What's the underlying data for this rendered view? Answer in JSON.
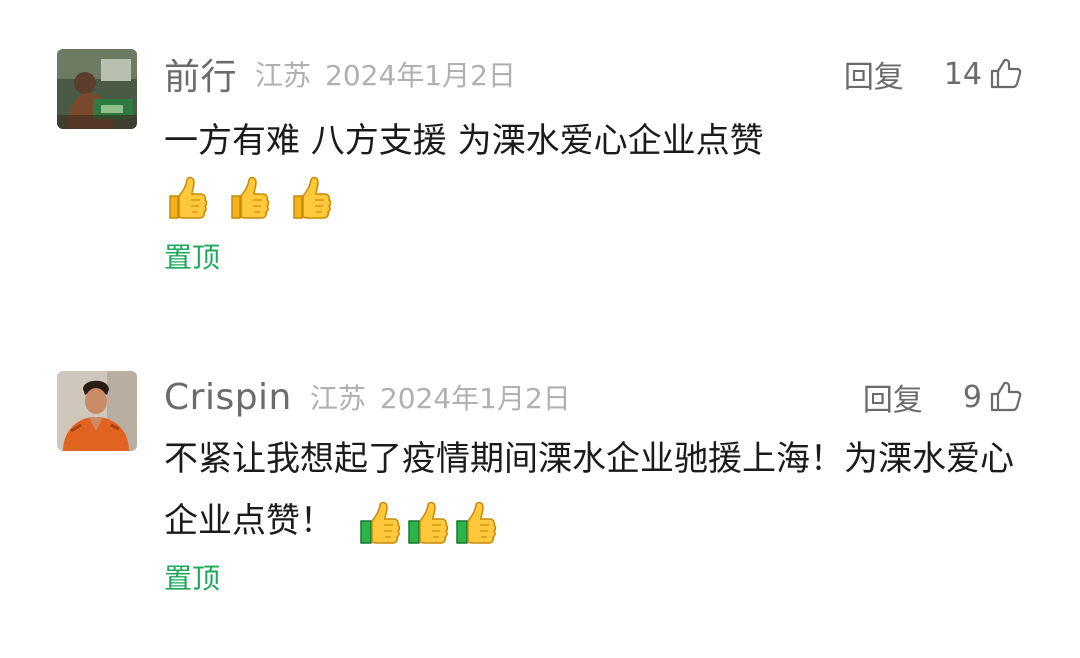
{
  "comments": [
    {
      "name": "前行",
      "location": "江苏",
      "date": "2024年1月2日",
      "reply_label": "回复",
      "like_count": "14",
      "text": "一方有难 八方支援  为溧水爱心企业点赞",
      "emoji_count": 3,
      "pin_label": "置顶",
      "avatar_icon": "user-avatar-photo"
    },
    {
      "name": "Crispin",
      "location": "江苏",
      "date": "2024年1月2日",
      "reply_label": "回复",
      "like_count": "9",
      "text": "不紧让我想起了疫情期间溧水企业驰援上海！为溧水爱心企业点赞！",
      "emoji_count": 3,
      "pin_label": "置顶",
      "avatar_icon": "user-avatar-photo"
    }
  ],
  "colors": {
    "name": "#6b6b6b",
    "meta": "#b0b0b0",
    "text": "#1b1b1b",
    "pin": "#1ea85b"
  },
  "icons": {
    "like": "thumbs-up-outline-icon",
    "emoji": "thumbs-up-emoji"
  }
}
